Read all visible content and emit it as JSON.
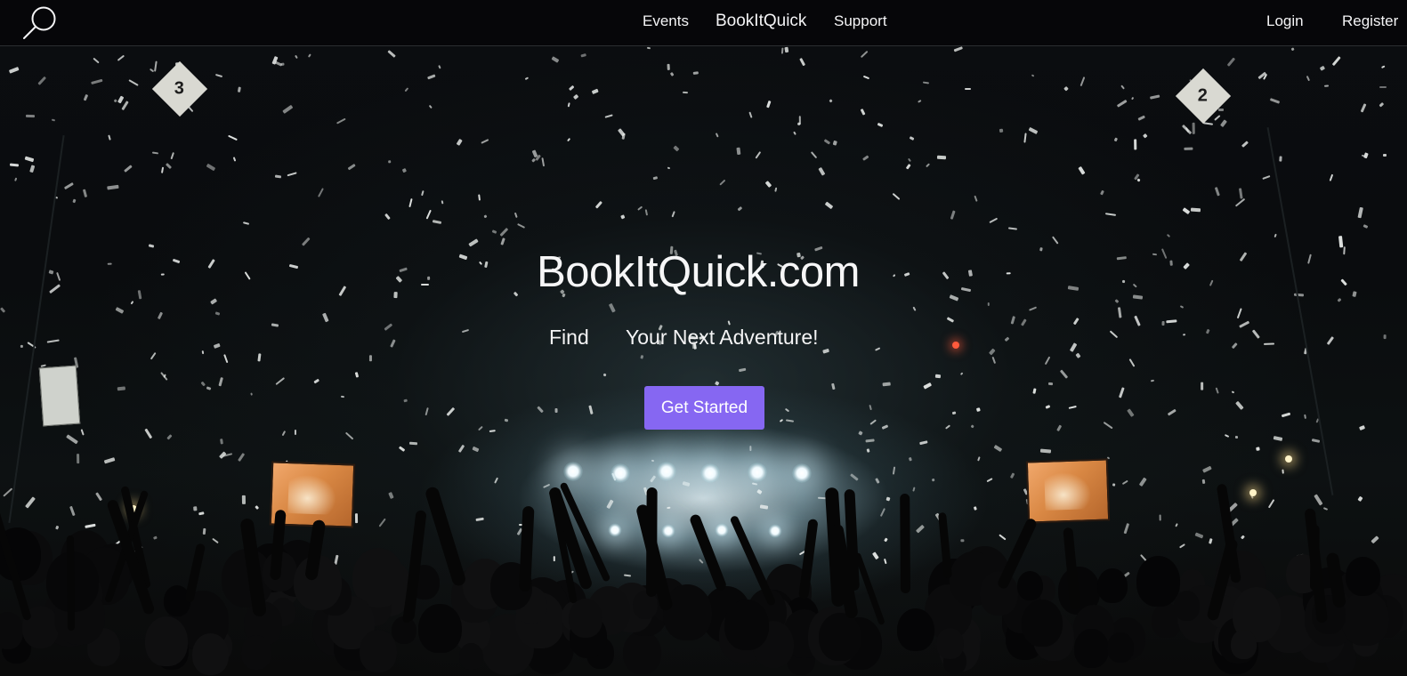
{
  "navbar": {
    "search_icon": "search-icon",
    "links": {
      "events": "Events",
      "brand": "BookItQuick",
      "support": "Support",
      "login": "Login",
      "register": "Register"
    }
  },
  "hero": {
    "title": "BookItQuick.com",
    "tagline_part1": "Find",
    "tagline_part2": "Your Next Adventure!",
    "cta_label": "Get Started",
    "background": "concert crowd with confetti and stage lights"
  },
  "colors": {
    "accent": "#8667f2",
    "navbar_bg": "#060608",
    "text": "#f4f4f6"
  }
}
